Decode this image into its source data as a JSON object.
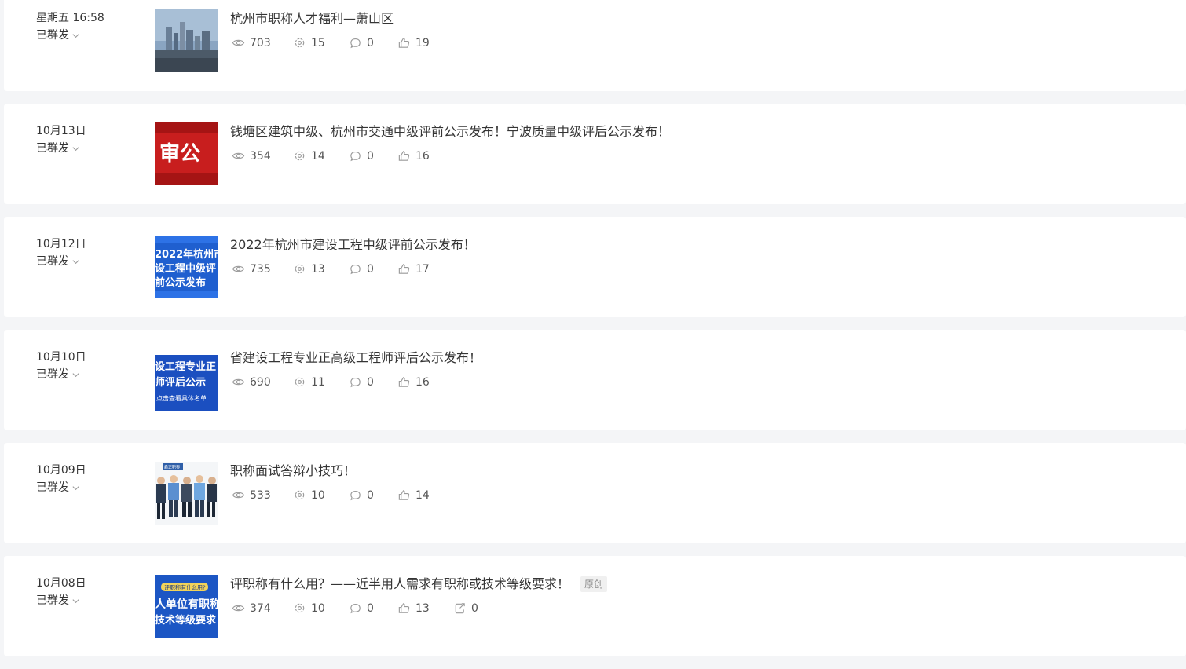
{
  "posts": [
    {
      "date": "星期五 16:58",
      "status": "已群发",
      "title": "杭州市职称人才福利—萧山区",
      "views": "703",
      "shares": "15",
      "comments": "0",
      "likes": "19",
      "thumb_text": []
    },
    {
      "date": "10月13日",
      "status": "已群发",
      "title": "钱塘区建筑中级、杭州市交通中级评前公示发布！宁波质量中级评后公示发布！",
      "views": "354",
      "shares": "14",
      "comments": "0",
      "likes": "16",
      "thumb_text": [
        "审公"
      ]
    },
    {
      "date": "10月12日",
      "status": "已群发",
      "title": "2022年杭州市建设工程中级评前公示发布！",
      "views": "735",
      "shares": "13",
      "comments": "0",
      "likes": "17",
      "thumb_text": [
        "2022年杭州市",
        "设工程中级评",
        "前公示发布"
      ]
    },
    {
      "date": "10月10日",
      "status": "已群发",
      "title": "省建设工程专业正高级工程师评后公示发布！",
      "views": "690",
      "shares": "11",
      "comments": "0",
      "likes": "16",
      "thumb_text": [
        "设工程专业正",
        "师评后公示",
        "点击查看具体名单"
      ]
    },
    {
      "date": "10月09日",
      "status": "已群发",
      "title": "职称面试答辩小技巧！",
      "views": "533",
      "shares": "10",
      "comments": "0",
      "likes": "14",
      "thumb_text": [
        "鑫正职称"
      ]
    },
    {
      "date": "10月08日",
      "status": "已群发",
      "title": "评职称有什么用？——近半用人需求有职称或技术等级要求！",
      "badge": "原创",
      "views": "374",
      "shares": "10",
      "comments": "0",
      "likes": "13",
      "forwards": "0",
      "thumb_text": [
        "评职称有什么用?",
        "人单位有职称",
        "技术等级要求"
      ]
    }
  ],
  "colors": {
    "background": "#f4f5f7",
    "card": "#ffffff",
    "text": "#353535",
    "icon": "#9a9a9a"
  },
  "icons": {
    "views": "eye-icon",
    "shares": "share-gear-icon",
    "comments": "comment-icon",
    "likes": "thumb-up-icon",
    "forwards": "forward-icon",
    "status": "chevron-down-icon"
  }
}
